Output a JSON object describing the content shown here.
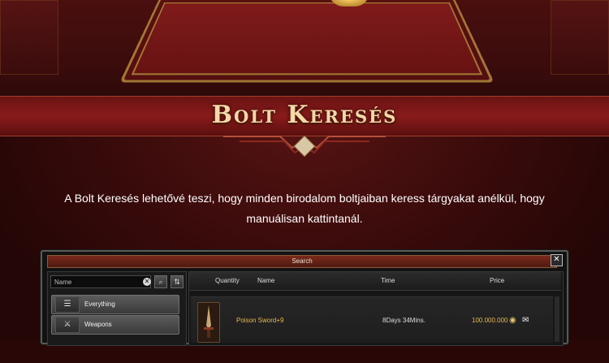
{
  "page": {
    "title": "Bolt Keresés",
    "description": "A Bolt Keresés lehetővé teszi, hogy minden birodalom boltjaiban keress tárgyakat anélkül, hogy manuálisan kattintanál."
  },
  "window": {
    "title": "Search",
    "close_label": "✕"
  },
  "search": {
    "placeholder": "Name"
  },
  "categories": [
    {
      "label": "Everything",
      "icon": "list-icon"
    },
    {
      "label": "Weapons",
      "icon": "sword-icon"
    }
  ],
  "table": {
    "columns": [
      "Quantity",
      "Name",
      "Time",
      "Price"
    ],
    "rows": [
      {
        "name": "Poison Sword+9",
        "time": "8Days 34Mins.",
        "price": "100.000.000",
        "icon": "poison-sword-icon"
      }
    ]
  },
  "colors": {
    "item_name": "#e7b84a",
    "price": "#e7b84a",
    "title": "#f3d9a8"
  }
}
